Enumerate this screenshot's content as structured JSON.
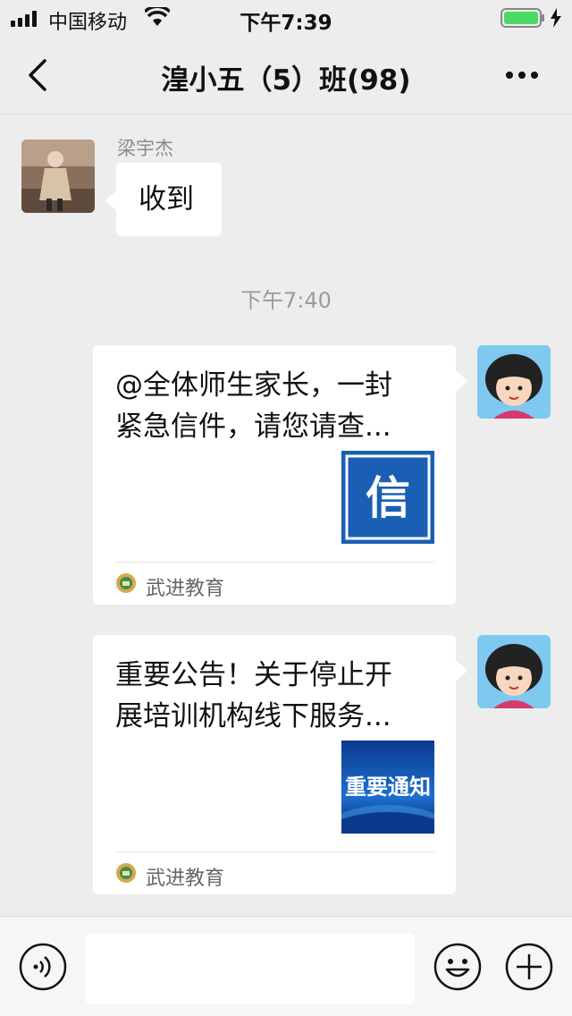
{
  "status_bar": {
    "carrier": "中国移动",
    "time": "下午7:39",
    "icons": [
      "signal-icon",
      "wifi-icon",
      "battery-icon",
      "charging-icon"
    ]
  },
  "nav": {
    "title": "湟小五（5）班(98)",
    "icons": [
      "back-icon",
      "more-icon"
    ]
  },
  "messages": [
    {
      "type": "text",
      "sender": "梁宇杰",
      "text": "收到"
    },
    {
      "type": "timestamp",
      "text": "下午7:40"
    },
    {
      "type": "article",
      "title": "@全体师生家长，一封紧急信件，请您请查...",
      "title_lines": [
        "@全体师生家长，一封",
        "紧急信件，请您请查..."
      ],
      "thumb_text": "信",
      "source": "武进教育"
    },
    {
      "type": "article",
      "title": "重要公告！关于停止开展培训机构线下服务...",
      "title_lines": [
        "重要公告！关于停止开",
        "展培训机构线下服务..."
      ],
      "thumb_text": "重要通知",
      "source": "武进教育"
    }
  ],
  "input_bar": {
    "placeholder": "",
    "icons": [
      "voice-icon",
      "emoji-icon",
      "plus-icon"
    ]
  },
  "colors": {
    "background": "#ededed",
    "bubble": "#ffffff",
    "battery_green": "#4cd964",
    "thumb_blue": "#1a5fb4"
  }
}
